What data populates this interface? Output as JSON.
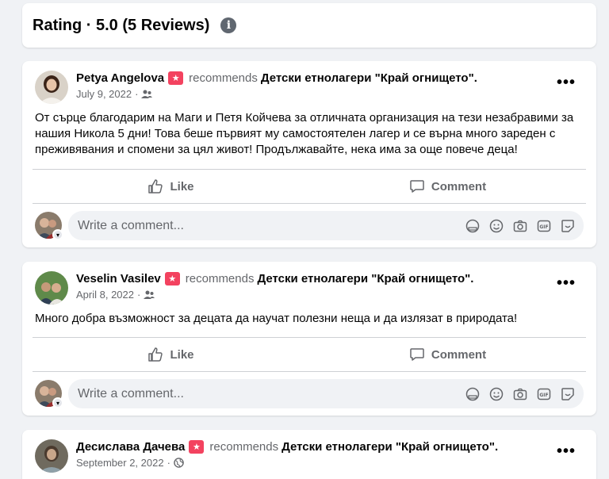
{
  "rating": {
    "title": "Rating · 5.0 (5 Reviews)"
  },
  "reviews": [
    {
      "author": "Petya Angelova",
      "recommends": "recommends",
      "page": "Детски етнолагери \"Край огнището\".",
      "date": "July 9, 2022",
      "audience_icon": "friends-icon",
      "text": "От сърце благодарим на Маги и Петя Койчева за отличната организация на тези незабравими за нашия Никола 5 дни! Това беше първият му самостоятелен лагер и се върна много зареден с преживявания и спомени за цял живот! Продължавайте, нека има за още повече деца!"
    },
    {
      "author": "Veselin Vasilev",
      "recommends": "recommends",
      "page": "Детски етнолагери \"Край огнището\".",
      "date": "April 8, 2022",
      "audience_icon": "friends-icon",
      "text": "Много добра възможност за децата да научат полезни неща и да излязат в природата!"
    },
    {
      "author": "Десислава Дачева",
      "recommends": "recommends",
      "page": "Детски етнолагери \"Край огнището\".",
      "date": "September 2, 2022",
      "audience_icon": "globe-icon",
      "text": ""
    }
  ],
  "actions": {
    "like": "Like",
    "comment": "Comment"
  },
  "comment_input": {
    "placeholder": "Write a comment..."
  },
  "colors": {
    "recommend_badge": "#f3425f",
    "secondary_text": "#65676b",
    "background": "#f0f2f5"
  }
}
